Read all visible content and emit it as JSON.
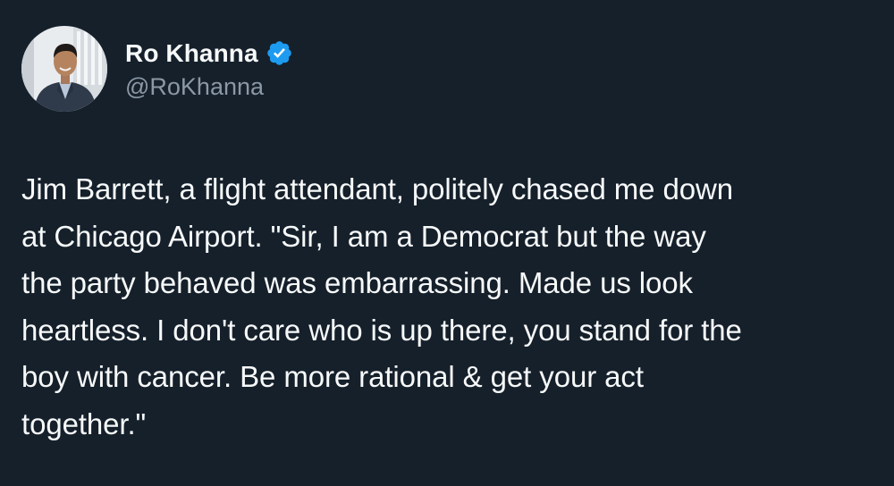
{
  "author": {
    "display_name": "Ro Khanna",
    "handle": "@RoKhanna",
    "verified": true,
    "verified_icon": "verified-badge-icon",
    "verified_color": "#1d9bf0"
  },
  "tweet": {
    "text": "Jim Barrett, a flight attendant, politely chased me down\nat Chicago Airport. \"Sir, I am a Democrat but the way\nthe party behaved was embarrassing. Made us look\nheartless. I don't care who is up there, you stand for the\nboy with cancer. Be more rational & get your act\ntogether.\""
  },
  "theme": {
    "background": "#15202b",
    "text_primary": "#f7f9f9",
    "text_secondary": "#8b98a5"
  }
}
